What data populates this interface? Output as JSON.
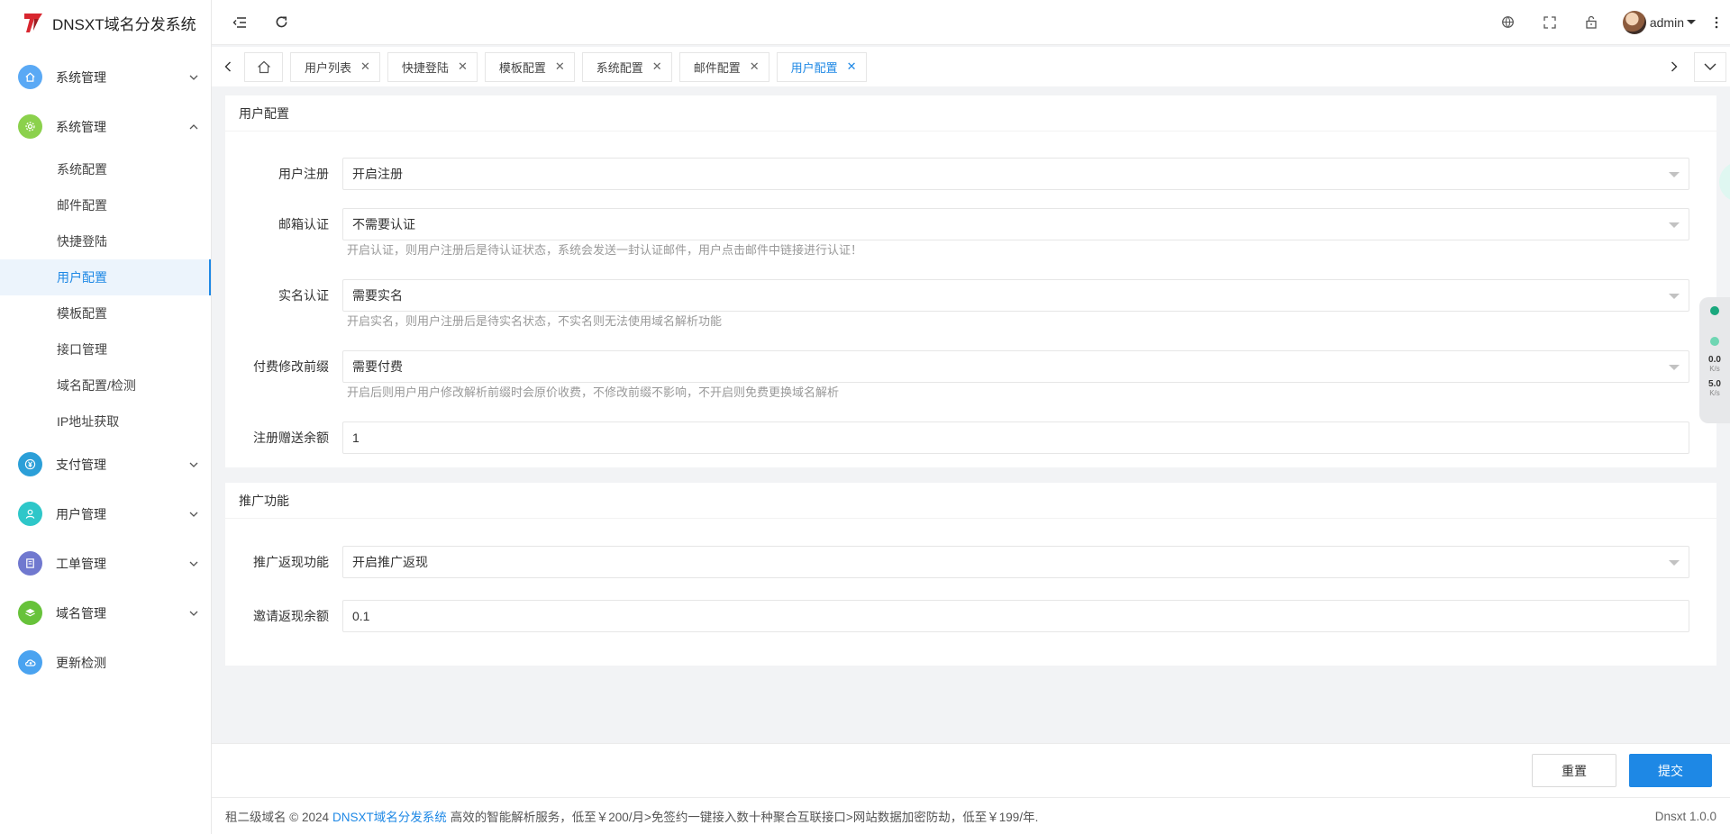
{
  "app": {
    "title": "DNSXT域名分发系统",
    "brand_color": "#1e88e5"
  },
  "sidebar": {
    "menu": [
      {
        "label": "系统管理",
        "icon": "home-icon",
        "color": "#5aa9f5",
        "expanded": false
      },
      {
        "label": "系统管理",
        "icon": "gear-icon",
        "color": "#8bd14c",
        "expanded": true
      }
    ],
    "submenu": [
      {
        "label": "系统配置",
        "active": false
      },
      {
        "label": "邮件配置",
        "active": false
      },
      {
        "label": "快捷登陆",
        "active": false
      },
      {
        "label": "用户配置",
        "active": true
      },
      {
        "label": "模板配置",
        "active": false
      },
      {
        "label": "接口管理",
        "active": false
      },
      {
        "label": "域名配置/检测",
        "active": false
      },
      {
        "label": "IP地址获取",
        "active": false
      }
    ],
    "menu_bottom": [
      {
        "label": "支付管理",
        "icon": "yuan-icon",
        "color": "#2b9fd8"
      },
      {
        "label": "用户管理",
        "icon": "user-icon",
        "color": "#2ec7c9"
      },
      {
        "label": "工单管理",
        "icon": "ticket-icon",
        "color": "#7078cf"
      },
      {
        "label": "域名管理",
        "icon": "layers-icon",
        "color": "#67c23a"
      },
      {
        "label": "更新检测",
        "icon": "cloud-icon",
        "color": "#4aa3f0"
      }
    ]
  },
  "header": {
    "user_name": "admin"
  },
  "tabs": [
    {
      "label": "用户列表",
      "active": false
    },
    {
      "label": "快捷登陆",
      "active": false
    },
    {
      "label": "模板配置",
      "active": false
    },
    {
      "label": "系统配置",
      "active": false
    },
    {
      "label": "邮件配置",
      "active": false
    },
    {
      "label": "用户配置",
      "active": true
    }
  ],
  "user_config": {
    "section_title": "用户配置",
    "registration": {
      "label": "用户注册",
      "value": "开启注册"
    },
    "email_verify": {
      "label": "邮箱认证",
      "value": "不需要认证",
      "help": "开启认证，则用户注册后是待认证状态，系统会发送一封认证邮件，用户点击邮件中链接进行认证！"
    },
    "realname": {
      "label": "实名认证",
      "value": "需要实名",
      "help": "开启实名，则用户注册后是待实名状态，不实名则无法使用域名解析功能"
    },
    "prefix_fee": {
      "label": "付费修改前缀",
      "value": "需要付费",
      "help": "开启后则用户用户修改解析前缀时会原价收费，不修改前缀不影响，不开启则免费更换域名解析"
    },
    "bonus": {
      "label": "注册赠送余额",
      "value": "1"
    }
  },
  "promotion": {
    "section_title": "推广功能",
    "cashback": {
      "label": "推广返现功能",
      "value": "开启推广返现"
    },
    "invite_bonus": {
      "label": "邀请返现余额",
      "value": "0.1"
    }
  },
  "actions": {
    "reset": "重置",
    "submit": "提交"
  },
  "footer": {
    "prefix": "租二级域名 © 2024",
    "link": "DNSXT域名分发系统",
    "suffix": "高效的智能解析服务，低至￥200/月>免签约一键接入数十种聚合互联接口>网站数据加密防劫，低至￥199/年.",
    "version": "Dnsxt 1.0.0"
  },
  "net_widget": {
    "up": "0.0",
    "up_unit": "K/s",
    "down": "5.0",
    "down_unit": "K/s"
  }
}
